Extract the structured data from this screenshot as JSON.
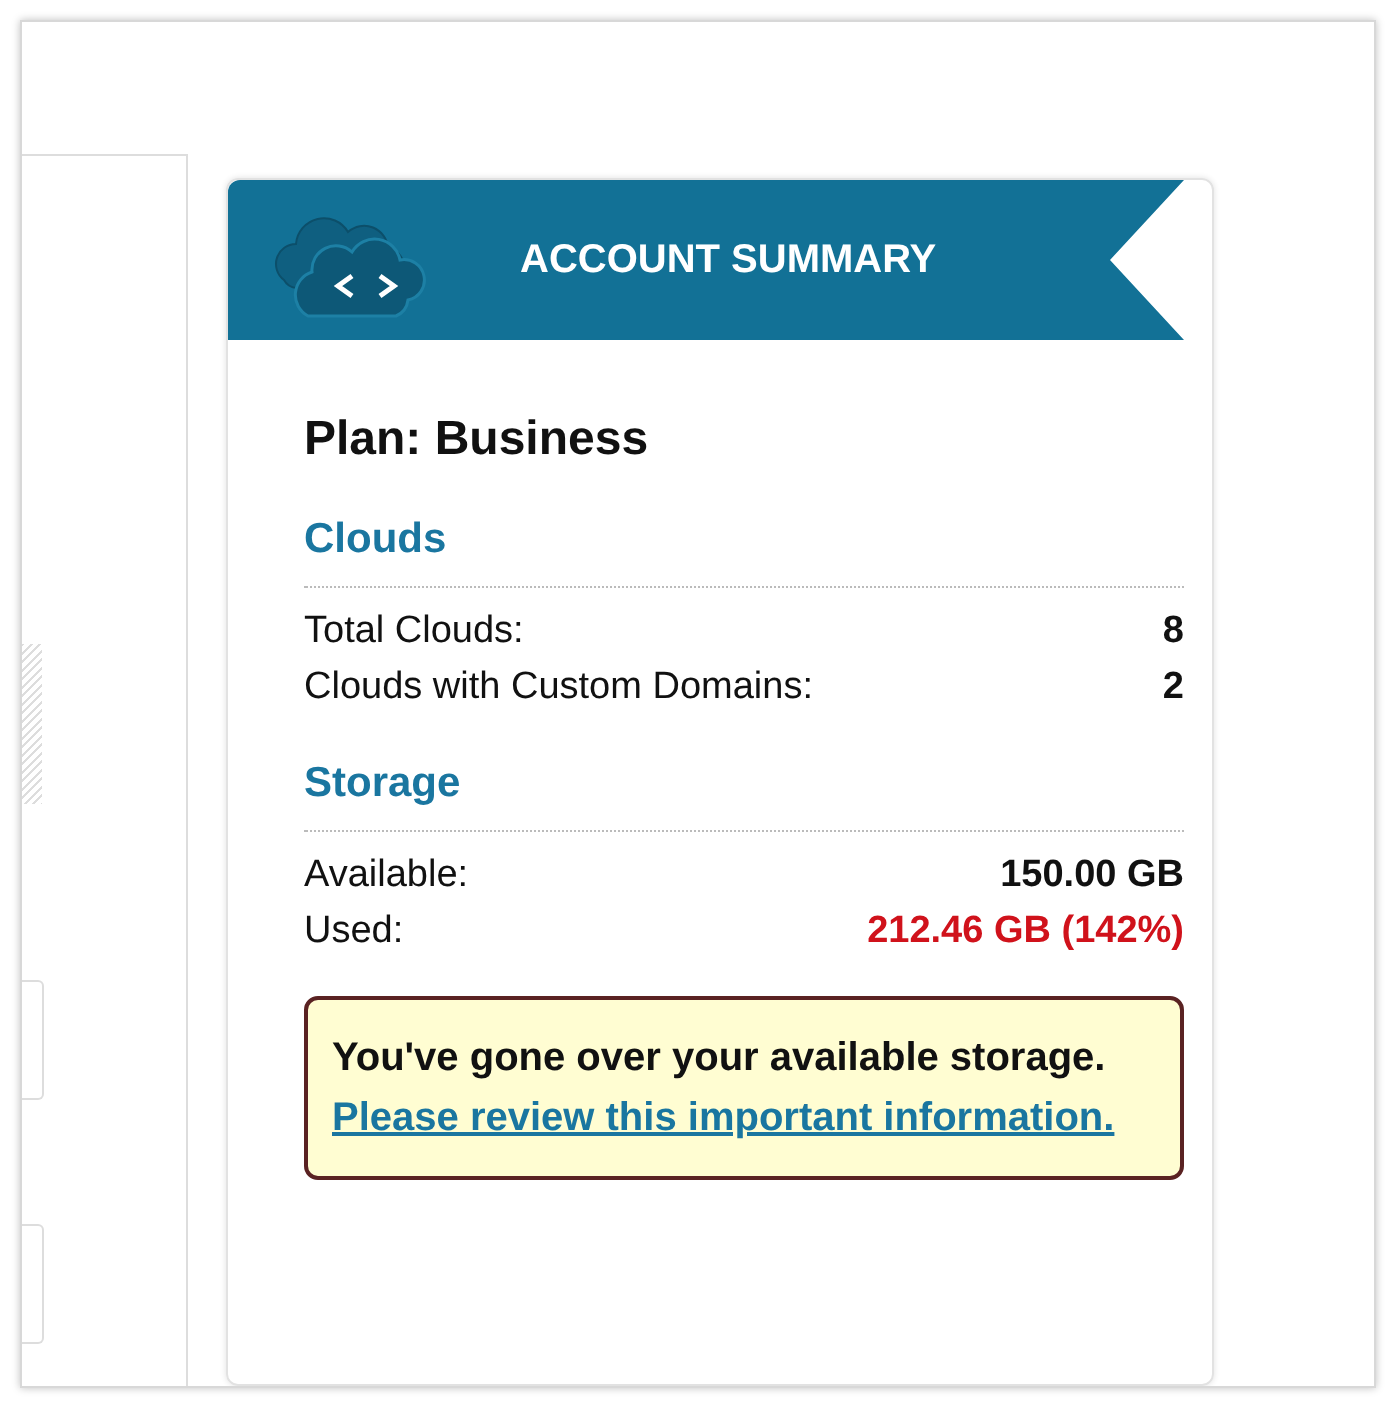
{
  "panel": {
    "title": "ACCOUNT SUMMARY",
    "plan": "Plan: Business",
    "sections": [
      {
        "heading": "Clouds",
        "rows": [
          {
            "label": "Total Clouds:",
            "value": "8",
            "alert": false
          },
          {
            "label": "Clouds with Custom Domains:",
            "value": "2",
            "alert": false
          }
        ]
      },
      {
        "heading": "Storage",
        "rows": [
          {
            "label": "Available:",
            "value": "150.00 GB",
            "alert": false
          },
          {
            "label": "Used:",
            "value": "212.46 GB (142%)",
            "alert": true
          }
        ]
      }
    ],
    "warning": {
      "text": "You've gone over your available storage.",
      "link": "Please review this important information."
    }
  }
}
